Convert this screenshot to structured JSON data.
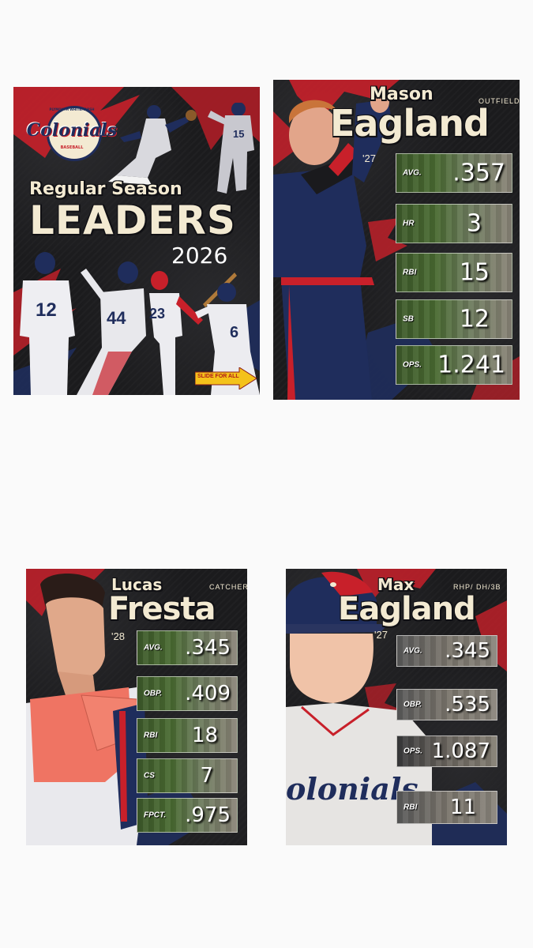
{
  "cover": {
    "logo_text": "Colonials",
    "logo_arc_top": "PLYMOUTH WHITEMARSH",
    "logo_arc_bottom": "BASEBALL",
    "title_line1": "Regular Season",
    "title_line2": "LEADERS",
    "year": "2026",
    "slide_label": "SLIDE FOR ALL",
    "jersey_numbers": [
      "15",
      "12",
      "44",
      "23",
      "6"
    ]
  },
  "cards": [
    {
      "first_name": "Mason",
      "last_name": "Eagland",
      "position": "OUTFIELD",
      "class_year": "'27",
      "stats": [
        {
          "label": "AVG.",
          "value": ".357"
        },
        {
          "label": "HR",
          "value": "3"
        },
        {
          "label": "RBI",
          "value": "15"
        },
        {
          "label": "SB",
          "value": "12"
        },
        {
          "label": "OPS.",
          "value": "1.241"
        }
      ]
    },
    {
      "first_name": "Lucas",
      "last_name": "Fresta",
      "position": "CATCHER",
      "class_year": "'28",
      "stats": [
        {
          "label": "AVG.",
          "value": ".345"
        },
        {
          "label": "OBP.",
          "value": ".409"
        },
        {
          "label": "RBI",
          "value": "18"
        },
        {
          "label": "CS",
          "value": "7"
        },
        {
          "label": "FPCT.",
          "value": ".975"
        }
      ]
    },
    {
      "first_name": "Max",
      "last_name": "Eagland",
      "position": "RHP/ DH/3B",
      "class_year": "'27",
      "jersey_text": "olonials",
      "stats": [
        {
          "label": "AVG.",
          "value": ".345"
        },
        {
          "label": "OBP.",
          "value": ".535"
        },
        {
          "label": "OPS.",
          "value": "1.087"
        },
        {
          "label": "RBI",
          "value": "11"
        }
      ]
    }
  ],
  "colors": {
    "accent_red": "#c8202a",
    "navy": "#1f2d5c",
    "cream": "#f3ead2",
    "dark": "#1b1b1d"
  }
}
